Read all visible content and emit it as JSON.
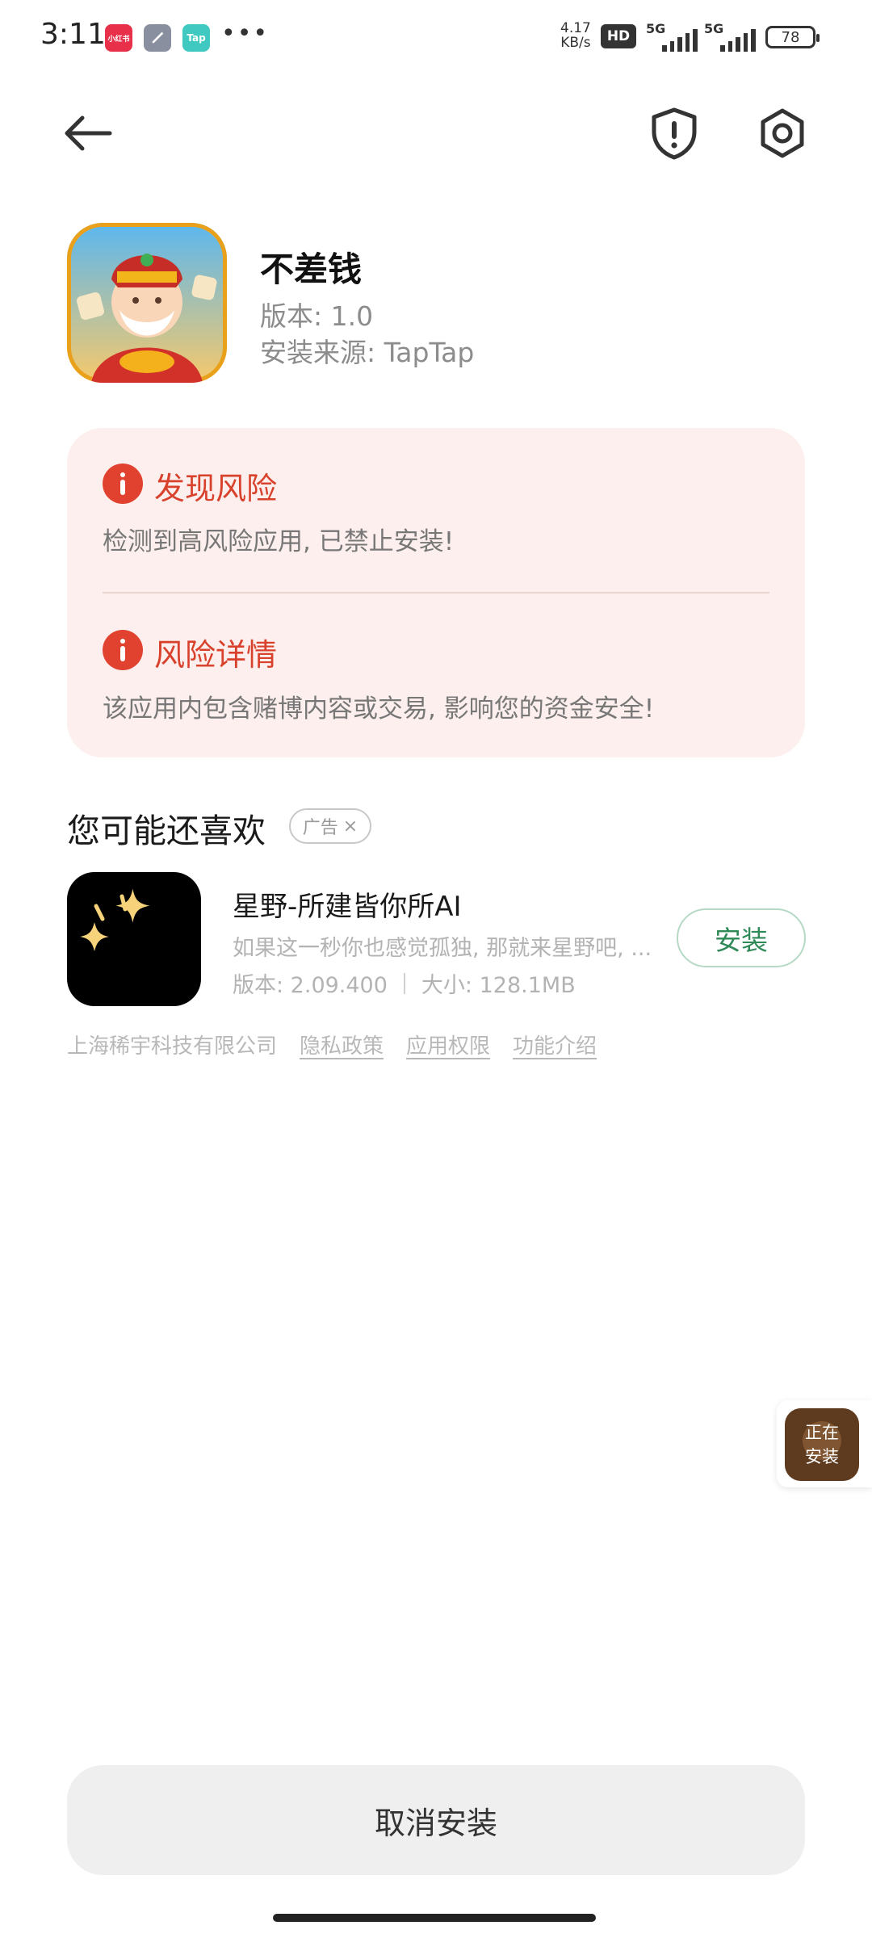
{
  "status_bar": {
    "time": "3:11",
    "apps": [
      "小红书",
      "tool",
      "Tap"
    ],
    "more": "•••",
    "net_speed_value": "4.17",
    "net_speed_unit": "KB/s",
    "hd_label": "HD",
    "network_1": "5G",
    "network_2": "5G",
    "battery": "78"
  },
  "nav": {
    "back_icon": "back-arrow-icon",
    "shield_icon": "shield-alert-icon",
    "settings_icon": "settings-hex-icon"
  },
  "app": {
    "name": "不差钱",
    "version": "版本: 1.0",
    "source": "安装来源: TapTap"
  },
  "risk": {
    "found_title": "发现风险",
    "found_text": "检测到高风险应用, 已禁止安装!",
    "detail_title": "风险详情",
    "detail_text": "该应用内包含赌博内容或交易, 影响您的资金安全!"
  },
  "recommend": {
    "title": "您可能还喜欢",
    "ad_label": "广告",
    "ad_close": "×",
    "item": {
      "name": "星野-所建皆你所AI",
      "description": "如果这一秒你也感觉孤独, 那就来星野吧, ...",
      "version": "版本: 2.09.400",
      "size": "大小: 128.1MB",
      "install_label": "安装"
    }
  },
  "footer": {
    "company": "上海稀宇科技有限公司",
    "privacy": "隐私政策",
    "permissions": "应用权限",
    "features": "功能介绍"
  },
  "floating": {
    "line1": "正在",
    "line2": "安装"
  },
  "cancel_label": "取消安装",
  "colors": {
    "risk_red": "#d8412c",
    "risk_bg": "#fdefed",
    "install_green": "#2f8a58"
  }
}
